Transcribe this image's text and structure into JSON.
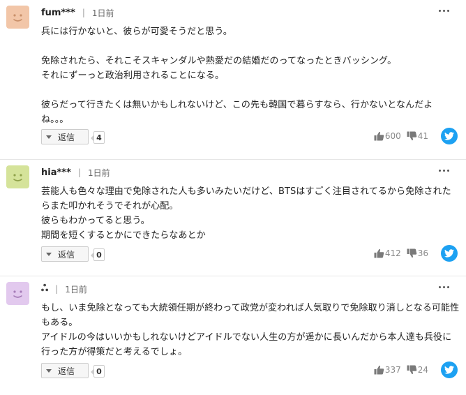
{
  "comments": [
    {
      "username": "fum***",
      "time": "1日前",
      "avatar_color": "#f2c6a8",
      "face_color": "#c9906a",
      "body": "兵には行かないと、彼らが可愛そうだと思う。\n\n免除されたら、それこそスキャンダルや熱愛だの結婚だのってなったときバッシング。\nそれにずーっと政治利用されることになる。\n\n彼らだって行きたくは無いかもしれないけど、この先も韓国で暮らすなら、行かないとなんだよね。。。",
      "reply_label": "返信",
      "reply_count": "4",
      "likes": "600",
      "dislikes": "41"
    },
    {
      "username": "hia***",
      "time": "1日前",
      "avatar_color": "#d5e39a",
      "face_color": "#8fa14a",
      "body": "芸能人も色々な理由で免除された人も多いみたいだけど、BTSはすごく注目されてるから免除されたらまた叩かれそうでそれが心配。\n彼らもわかってると思う。\n期間を短くするとかにできたらなあとか",
      "reply_label": "返信",
      "reply_count": "0",
      "likes": "412",
      "dislikes": "36"
    },
    {
      "username": "ஃ",
      "time": "1日前",
      "avatar_color": "#e2c9ee",
      "face_color": "#a57bb8",
      "body": "もし、いま免除となっても大統領任期が終わって政党が変われば人気取りで免除取り消しとなる可能性もある。\nアイドルの今はいいかもしれないけどアイドルでない人生の方が遥かに長いんだから本人達も兵役に行った方が得策だと考えるでしょ。",
      "reply_label": "返信",
      "reply_count": "0",
      "likes": "337",
      "dislikes": "24"
    }
  ],
  "colors": {
    "twitter": "#1da1f2",
    "border": "#e6e6e6"
  }
}
